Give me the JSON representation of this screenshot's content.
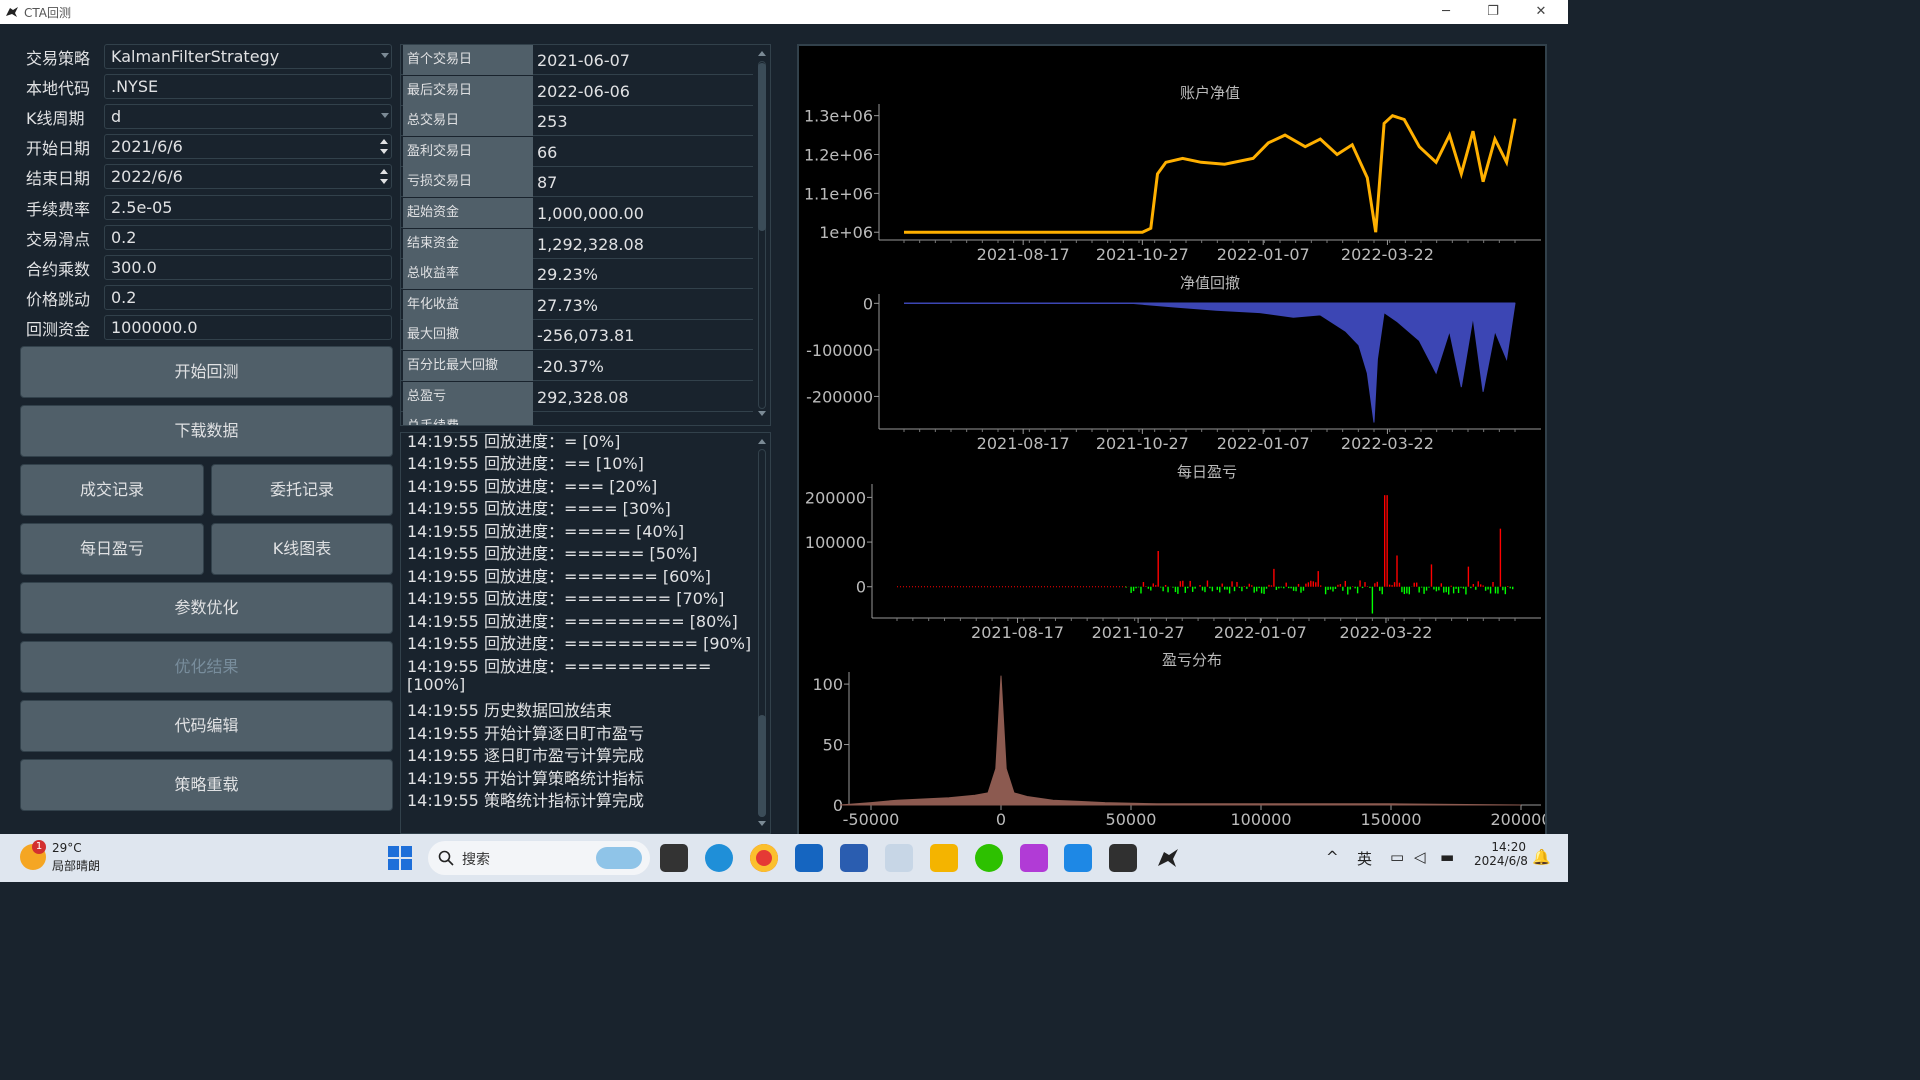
{
  "window": {
    "title": "CTA回测",
    "min": "─",
    "max": "❐",
    "close": "✕"
  },
  "form": [
    {
      "label": "交易策略",
      "value": "KalmanFilterStrategy",
      "kind": "combo"
    },
    {
      "label": "本地代码",
      "value": ".NYSE",
      "kind": "text"
    },
    {
      "label": "K线周期",
      "value": "d",
      "kind": "combo"
    },
    {
      "label": "开始日期",
      "value": "2021/6/6",
      "kind": "date"
    },
    {
      "label": "结束日期",
      "value": "2022/6/6",
      "kind": "date"
    },
    {
      "label": "手续费率",
      "value": "2.5e-05",
      "kind": "text"
    },
    {
      "label": "交易滑点",
      "value": "0.2",
      "kind": "text"
    },
    {
      "label": "合约乘数",
      "value": "300.0",
      "kind": "text"
    },
    {
      "label": "价格跳动",
      "value": "0.2",
      "kind": "text"
    },
    {
      "label": "回测资金",
      "value": "1000000.0",
      "kind": "text"
    }
  ],
  "buttons": {
    "start_backtest": "开始回测",
    "download_data": "下载数据",
    "trade_records": "成交记录",
    "order_records": "委托记录",
    "daily_pnl": "每日盈亏",
    "kline_chart": "K线图表",
    "param_optimize": "参数优化",
    "optimize_result": "优化结果",
    "code_edit": "代码编辑",
    "strategy_reload": "策略重载"
  },
  "stats": [
    {
      "k": "首个交易日",
      "v": "2021-06-07"
    },
    {
      "k": "最后交易日",
      "v": "2022-06-06"
    },
    {
      "k": "总交易日",
      "v": "253"
    },
    {
      "k": "盈利交易日",
      "v": "66"
    },
    {
      "k": "亏损交易日",
      "v": "87"
    },
    {
      "k": "起始资金",
      "v": "1,000,000.00"
    },
    {
      "k": "结束资金",
      "v": "1,292,328.08"
    },
    {
      "k": "总收益率",
      "v": "29.23%"
    },
    {
      "k": "年化收益",
      "v": "27.73%"
    },
    {
      "k": "最大回撤",
      "v": "-256,073.81"
    },
    {
      "k": "百分比最大回撤",
      "v": "-20.37%"
    },
    {
      "k": "总盈亏",
      "v": "292,328.08"
    },
    {
      "k": "总手续费",
      "v": ""
    }
  ],
  "log": [
    "14:19:55   回放进度：= [0%]",
    "14:19:55   回放进度：== [10%]",
    "14:19:55   回放进度：=== [20%]",
    "14:19:55   回放进度：==== [30%]",
    "14:19:55   回放进度：===== [40%]",
    "14:19:55   回放进度：====== [50%]",
    "14:19:55   回放进度：======= [60%]",
    "14:19:55   回放进度：======== [70%]",
    "14:19:55   回放进度：========= [80%]",
    "14:19:55   回放进度：========== [90%]",
    "14:19:55   回放进度：===========",
    "[100%]",
    "14:19:55   历史数据回放结束",
    "14:19:55   开始计算逐日盯市盈亏",
    "14:19:55   逐日盯市盈亏计算完成",
    "14:19:55   开始计算策略统计指标",
    "14:19:55   策略统计指标计算完成"
  ],
  "colors": {
    "balance": "#ffb000",
    "drawdown": "#3c46b4",
    "profit": "#ff0000",
    "loss": "#00ff00",
    "dist": "#8c5a50"
  },
  "chart_data": [
    {
      "type": "line",
      "title": "账户净值",
      "x_ticks": [
        "2021-08-17",
        "2021-10-27",
        "2022-01-07",
        "2022-03-22"
      ],
      "y_ticks": [
        "1e+06",
        "1.1e+06",
        "1.2e+06",
        "1.3e+06"
      ],
      "ylim": [
        980000,
        1330000
      ],
      "x": [
        "2021-06-07",
        "2021-10-27",
        "2021-11-01",
        "2021-11-05",
        "2021-11-10",
        "2021-11-20",
        "2021-12-01",
        "2021-12-15",
        "2022-01-01",
        "2022-01-10",
        "2022-01-20",
        "2022-02-01",
        "2022-02-10",
        "2022-02-20",
        "2022-03-01",
        "2022-03-10",
        "2022-03-15",
        "2022-03-20",
        "2022-03-25",
        "2022-04-01",
        "2022-04-10",
        "2022-04-20",
        "2022-04-28",
        "2022-05-05",
        "2022-05-12",
        "2022-05-18",
        "2022-05-25",
        "2022-06-01",
        "2022-06-06"
      ],
      "values": [
        1000000,
        1000000,
        1010000,
        1150000,
        1180000,
        1190000,
        1180000,
        1175000,
        1190000,
        1230000,
        1250000,
        1220000,
        1240000,
        1200000,
        1225000,
        1140000,
        1000000,
        1280000,
        1300000,
        1290000,
        1220000,
        1180000,
        1250000,
        1150000,
        1260000,
        1130000,
        1240000,
        1180000,
        1292328
      ]
    },
    {
      "type": "area",
      "title": "净值回撤",
      "x_ticks": [
        "2021-08-17",
        "2021-10-27",
        "2022-01-07",
        "2022-03-22"
      ],
      "y_ticks": [
        "0",
        "-100000",
        "-200000"
      ],
      "ylim": [
        -270000,
        20000
      ],
      "x": [
        "2021-06-07",
        "2021-10-20",
        "2021-11-15",
        "2021-12-10",
        "2022-01-05",
        "2022-01-25",
        "2022-02-10",
        "2022-02-25",
        "2022-03-05",
        "2022-03-10",
        "2022-03-14",
        "2022-03-16",
        "2022-03-20",
        "2022-03-28",
        "2022-04-10",
        "2022-04-20",
        "2022-04-28",
        "2022-05-05",
        "2022-05-12",
        "2022-05-18",
        "2022-05-25",
        "2022-06-01",
        "2022-06-06"
      ],
      "values": [
        0,
        0,
        -8000,
        -15000,
        -20000,
        -30000,
        -25000,
        -60000,
        -90000,
        -150000,
        -256073,
        -120000,
        -20000,
        -40000,
        -80000,
        -150000,
        -60000,
        -180000,
        -30000,
        -190000,
        -60000,
        -120000,
        0
      ]
    },
    {
      "type": "bar",
      "title": "每日盈亏",
      "x_ticks": [
        "2021-08-17",
        "2021-10-27",
        "2022-01-07",
        "2022-03-22"
      ],
      "y_ticks": [
        "0",
        "100000",
        "200000"
      ],
      "ylim": [
        -70000,
        230000
      ]
    },
    {
      "type": "area",
      "title": "盈亏分布",
      "x_ticks": [
        "-50000",
        "0",
        "50000",
        "100000",
        "150000",
        "200000"
      ],
      "y_ticks": [
        "0",
        "50",
        "100"
      ],
      "xlim": [
        -60000,
        210000
      ],
      "ylim": [
        0,
        110
      ]
    }
  ],
  "taskbar": {
    "temp": "29°C",
    "weather": "局部晴朗",
    "badge": "1",
    "search": "搜索",
    "ime": "英",
    "time": "14:20",
    "date": "2024/6/8"
  }
}
